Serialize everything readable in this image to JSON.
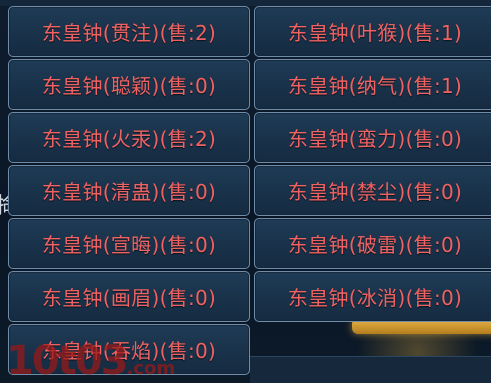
{
  "watermark": {
    "main": "10t03",
    "suffix": ".com"
  },
  "background": {
    "left_glyph": "掵"
  },
  "items": [
    {
      "label": "东皇钟(贯注)(售:2)"
    },
    {
      "label": "东皇钟(叶猴)(售:1)"
    },
    {
      "label": "东皇钟(聪颖)(售:0)"
    },
    {
      "label": "东皇钟(纳气)(售:1)"
    },
    {
      "label": "东皇钟(火汞)(售:2)"
    },
    {
      "label": "东皇钟(蛮力)(售:0)"
    },
    {
      "label": "东皇钟(清蛊)(售:0)"
    },
    {
      "label": "东皇钟(禁尘)(售:0)"
    },
    {
      "label": "东皇钟(宣晦)(售:0)"
    },
    {
      "label": "东皇钟(破雷)(售:0)"
    },
    {
      "label": "东皇钟(画眉)(售:0)"
    },
    {
      "label": "东皇钟(冰消)(售:0)"
    },
    {
      "label": "东皇钟(吞焰)(售:0)"
    }
  ],
  "colors": {
    "label_text": "#f06262",
    "button_border": "#6f8da9",
    "button_fill": "#19324a"
  }
}
